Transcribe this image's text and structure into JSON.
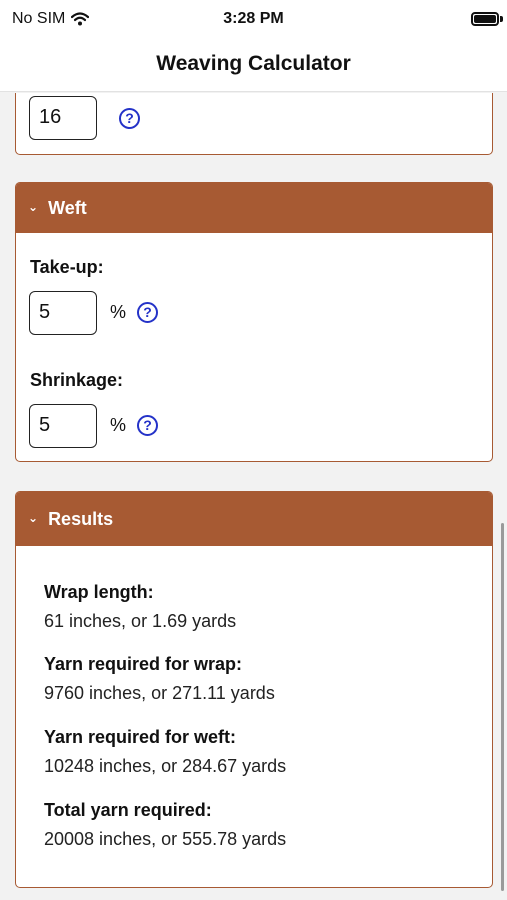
{
  "status": {
    "carrier": "No SIM",
    "time": "3:28 PM"
  },
  "nav": {
    "title": "Weaving Calculator"
  },
  "top_card": {
    "value": "16"
  },
  "weft": {
    "title": "Weft",
    "takeup_label": "Take-up:",
    "takeup_value": "5",
    "takeup_unit": "%",
    "shrinkage_label": "Shrinkage:",
    "shrinkage_value": "5",
    "shrinkage_unit": "%"
  },
  "results": {
    "title": "Results",
    "items": [
      {
        "label": "Wrap length:",
        "value": "61 inches, or 1.69 yards"
      },
      {
        "label": "Yarn required for wrap:",
        "value": "9760 inches, or 271.11 yards"
      },
      {
        "label": "Yarn required for weft:",
        "value": "10248 inches, or 284.67 yards"
      },
      {
        "label": "Total yarn required:",
        "value": "20008 inches, or 555.78 yards"
      }
    ]
  },
  "icons": {
    "help": "?",
    "chevron": "⌄"
  },
  "colors": {
    "accent": "#a75a33",
    "help_blue": "#2432c8"
  }
}
